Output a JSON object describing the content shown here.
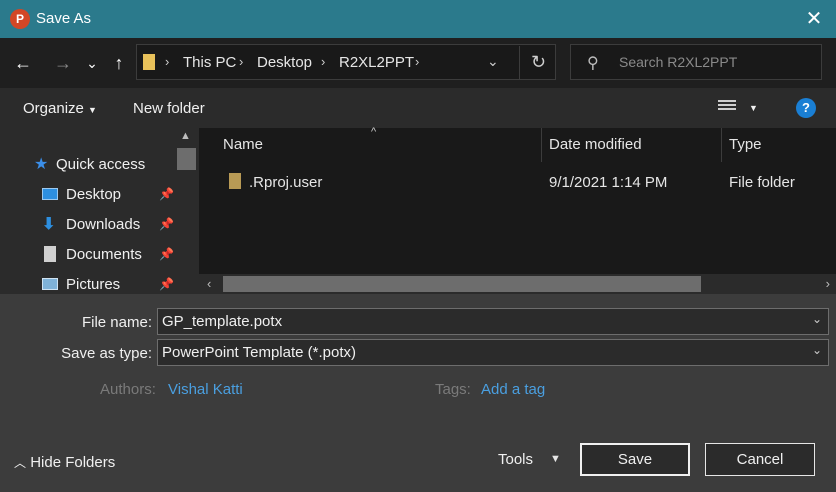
{
  "window": {
    "title": "Save As",
    "app_icon_letter": "P",
    "close_glyph": "✕"
  },
  "nav": {
    "back_glyph": "←",
    "forward_glyph": "→",
    "recent_glyph": "⌄",
    "up_glyph": "↑",
    "breadcrumbs": [
      "This PC",
      "Desktop",
      "R2XL2PPT"
    ],
    "search_placeholder": "Search R2XL2PPT"
  },
  "toolbar": {
    "organize": "Organize",
    "new_folder": "New folder",
    "help": "?"
  },
  "sidebar": {
    "items": [
      {
        "label": "Quick access",
        "icon": "star-icon",
        "color": "#3b8ee8"
      },
      {
        "label": "Desktop",
        "icon": "desktop-icon",
        "color": "#2d8fe0"
      },
      {
        "label": "Downloads",
        "icon": "download-icon",
        "color": "#2d8fe0"
      },
      {
        "label": "Documents",
        "icon": "document-icon",
        "color": "#d0d0d0"
      },
      {
        "label": "Pictures",
        "icon": "pictures-icon",
        "color": "#7fb2d8"
      }
    ]
  },
  "files": {
    "columns": [
      "Name",
      "Date modified",
      "Type"
    ],
    "rows": [
      {
        "name": ".Rproj.user",
        "date": "9/1/2021 1:14 PM",
        "type": "File folder"
      }
    ]
  },
  "form": {
    "file_name_label": "File name:",
    "file_name_value": "GP_template.potx",
    "type_label": "Save as type:",
    "type_value": "PowerPoint Template (*.potx)",
    "authors_label": "Authors:",
    "authors_value": "Vishal Katti",
    "tags_label": "Tags:",
    "tags_value": "Add a tag"
  },
  "footer": {
    "hide_folders": "Hide Folders",
    "tools": "Tools",
    "save": "Save",
    "cancel": "Cancel"
  },
  "colors": {
    "titlebar": "#2b7a8c",
    "link": "#4a9fe0",
    "accent": "#1a7fd4"
  }
}
